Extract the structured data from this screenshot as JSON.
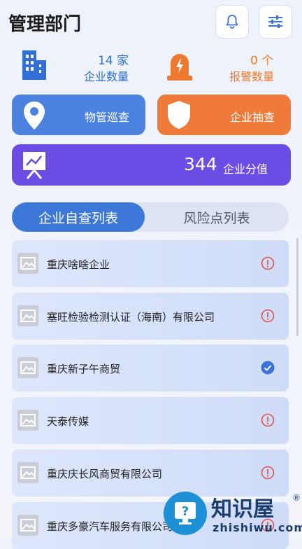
{
  "header": {
    "title": "管理部门",
    "bell_icon": "bell-icon",
    "filter_icon": "sliders-icon"
  },
  "stats": {
    "enterprise": {
      "count": "14 家",
      "label": "企业数量",
      "icon": "building-icon",
      "color": "#2f6fd6"
    },
    "alarm": {
      "count": "0 个",
      "label": "报警数量",
      "icon": "alarm-icon",
      "color": "#ef7a2f"
    }
  },
  "actions": {
    "patrol": {
      "label": "物管巡查",
      "icon": "location-pin-icon",
      "color": "#4b82e0"
    },
    "check": {
      "label": "企业抽查",
      "icon": "shield-icon",
      "color": "#f07a3a"
    },
    "score": {
      "value": "344",
      "label": "企业分值",
      "icon": "presentation-chart-icon",
      "color": "#6b4de6"
    }
  },
  "tabs": {
    "active": "企业自查列表",
    "inactive": "风险点列表"
  },
  "list": [
    {
      "name": "重庆啥啥企业",
      "status": "warning"
    },
    {
      "name": "塞旺检验检测认证（海南）有限公司",
      "status": "warning"
    },
    {
      "name": "重庆新子午商贸",
      "status": "done"
    },
    {
      "name": "天泰传媒",
      "status": "warning"
    },
    {
      "name": "重庆庆长风商贸有限公司",
      "status": "warning"
    },
    {
      "name": "重庆多豪汽车服务有限公司",
      "status": "warning"
    }
  ],
  "watermark": {
    "text": "知识屋",
    "sub": "zhishiwu.com",
    "reg": "®"
  }
}
